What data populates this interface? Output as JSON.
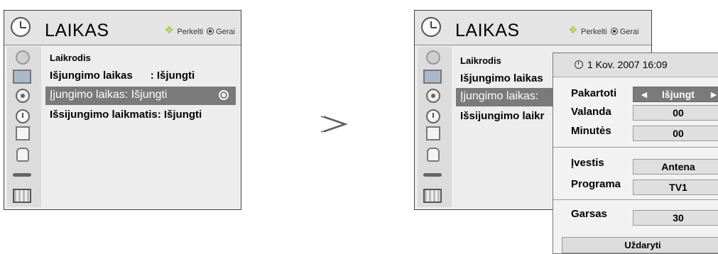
{
  "left_menu": {
    "title": "LAIKAS",
    "hint_move": "Perkelti",
    "hint_ok": "Gerai",
    "items": [
      {
        "label": "Laikrodis"
      },
      {
        "label": "Išjungimo laikas      : Išjungti"
      },
      {
        "label": "Įjungimo laikas: Išjungti"
      },
      {
        "label": "Išsijungimo laikmatis: Išjungti"
      }
    ]
  },
  "right_menu": {
    "title": "LAIKAS",
    "hint_move": "Perkelti",
    "hint_ok": "Gerai",
    "items": [
      {
        "label": "Laikrodis"
      },
      {
        "label": "Išjungimo laikas"
      },
      {
        "label": "Įjungimo laikas:"
      },
      {
        "label": "Išsijungimo laikr"
      }
    ]
  },
  "sidebar_icons": [
    "satellite-dish-icon",
    "tv-screen-icon",
    "disc-icon",
    "clock-icon",
    "clipboard-icon",
    "lock-icon",
    "plug-icon",
    "film-icon"
  ],
  "popup": {
    "datetime": "1 Kov. 2007 16:09",
    "rows": [
      {
        "label": "Pakartoti",
        "value": "Išjungt"
      },
      {
        "label": "Valanda",
        "value": "00"
      },
      {
        "label": "Minutės",
        "value": "00"
      },
      {
        "label": "Įvestis",
        "value": "Antena"
      },
      {
        "label": "Programa",
        "value": "TV1"
      },
      {
        "label": "Garsas",
        "value": "30"
      }
    ],
    "close_label": "Uždaryti"
  },
  "colors": {
    "hint_accent": "#9bcb3c",
    "selected_bg": "#7a7a7a"
  }
}
